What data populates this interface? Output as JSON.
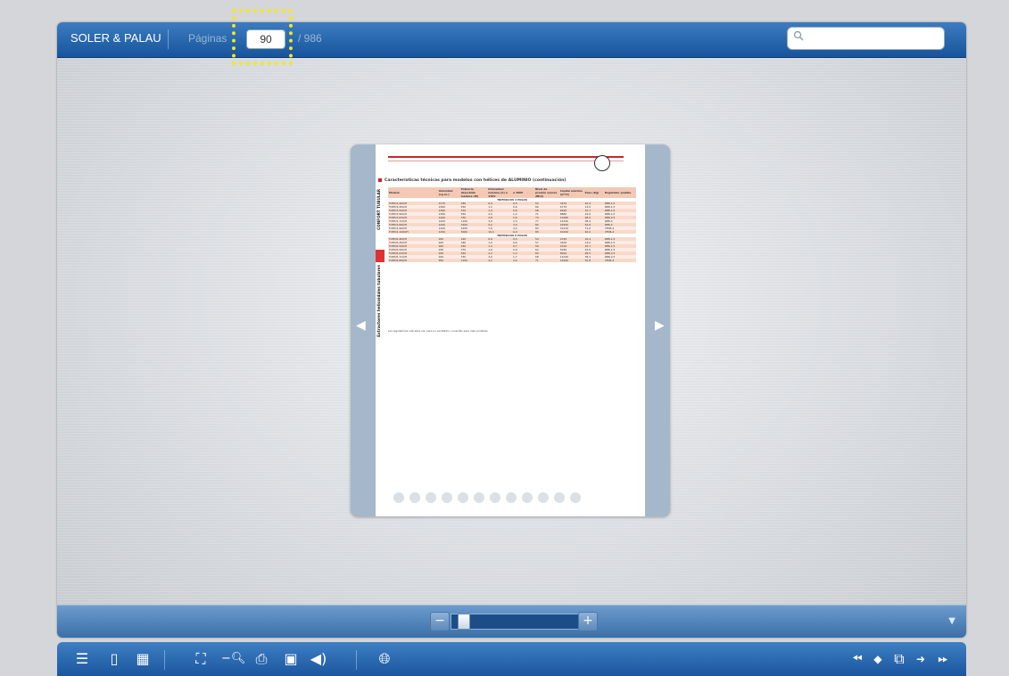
{
  "topbar": {
    "brand": "SOLER & PALAU",
    "pages_label": "Páginas",
    "current_page": "90",
    "total_pages": "/ 986",
    "search_placeholder": ""
  },
  "document": {
    "title": "Características técnicas para modelos con hélices de ALUMINIO (continuación)",
    "side_label_top": "CONFORT TUBULAR",
    "side_label_bottom": "Extractores helicoidales tubulares",
    "headers": [
      "Modelo",
      "Velocidad (r.p.m.)",
      "Potencia absorbida máxima (W)",
      "Intensidad máxima (A) a 230V",
      "a 400V",
      "Nivel de presión sonora dB(A)",
      "Caudal máximo (m³/h)",
      "Peso (Kg)",
      "Regulador posible"
    ],
    "band_4": "TRIFÁSICOS 4 POLOS",
    "band_6": "TRIFÁSICOS 6 POLOS",
    "rows_4": [
      [
        "TCBT/4-400/H",
        "1370",
        "180",
        "0,9",
        "0,5",
        "63",
        "3470",
        "10,4",
        "REB-1,5"
      ],
      [
        "TCBT/4-450/H",
        "1380",
        "250",
        "1,1",
        "0,6",
        "66",
        "4770",
        "13,0",
        "REB-1,5"
      ],
      [
        "TCBT/4-500/H",
        "1390",
        "370",
        "1,4",
        "0,8",
        "68",
        "6440",
        "15,7",
        "REB-1,5"
      ],
      [
        "TCBT/4-560/H",
        "1390",
        "550",
        "2,0",
        "1,2",
        "71",
        "8880",
        "22,6",
        "REB-1,5"
      ],
      [
        "TCBT/4-630/H",
        "1400",
        "750",
        "2,8",
        "1,6",
        "74",
        "12080",
        "28,5",
        "REB-2,5"
      ],
      [
        "TCBT/4-710/H",
        "1420",
        "1100",
        "3,9",
        "2,3",
        "77",
        "16700",
        "38,4",
        "REB-4"
      ],
      [
        "TCBT/4-800/H",
        "1440",
        "1500",
        "5,2",
        "3,0",
        "80",
        "22500",
        "52,8",
        "REB-4"
      ],
      [
        "TCBT/4-900/H",
        "1440",
        "2200",
        "7,6",
        "4,4",
        "83",
        "31210",
        "71,0",
        "VFKB-4"
      ],
      [
        "TCBT/4-1000/H",
        "1450",
        "3000",
        "10,4",
        "6,0",
        "85",
        "40100",
        "92,0",
        "VFKB-4"
      ]
    ],
    "rows_6": [
      [
        "TCBT/6-400/H",
        "920",
        "120",
        "0,9",
        "0,5",
        "54",
        "2330",
        "10,4",
        "REB-1,5"
      ],
      [
        "TCBT/6-450/H",
        "920",
        "180",
        "1,0",
        "0,6",
        "57",
        "3200",
        "13,0",
        "REB-1,5"
      ],
      [
        "TCBT/6-500/H",
        "920",
        "250",
        "1,3",
        "0,7",
        "59",
        "4310",
        "15,7",
        "REB-1,5"
      ],
      [
        "TCBT/6-560/H",
        "930",
        "370",
        "1,6",
        "0,9",
        "62",
        "5930",
        "22,6",
        "REB-1,5"
      ],
      [
        "TCBT/6-630/H",
        "930",
        "550",
        "2,2",
        "1,3",
        "65",
        "8020",
        "28,5",
        "REB-2,5"
      ],
      [
        "TCBT/6-710/H",
        "940",
        "750",
        "3,0",
        "1,7",
        "68",
        "11040",
        "38,4",
        "REB-2,5"
      ],
      [
        "TCBT/6-800/H",
        "950",
        "1100",
        "4,2",
        "2,4",
        "71",
        "14900",
        "52,8",
        "VFKB-4"
      ]
    ],
    "footnote": "Los reguladores indicados son para un ventilador; consultar para más unidades."
  },
  "zoom": {
    "level": 0.05
  }
}
